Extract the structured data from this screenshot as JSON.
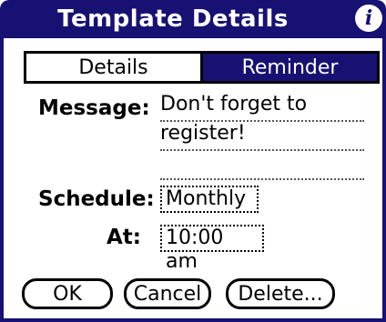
{
  "window": {
    "title": "Template Details",
    "info_icon": "info-icon"
  },
  "tabs": [
    {
      "label": "Details",
      "selected": false
    },
    {
      "label": "Reminder",
      "selected": true
    }
  ],
  "message": {
    "label": "Message:",
    "lines": [
      "Don't forget to",
      "register!",
      ""
    ]
  },
  "schedule": {
    "label": "Schedule:",
    "value": "Monthly"
  },
  "at": {
    "label": "At:",
    "value": "10:00 am"
  },
  "buttons": {
    "ok": "OK",
    "cancel": "Cancel",
    "delete": "Delete..."
  },
  "colors": {
    "accent": "#161172",
    "background": "#ffffff",
    "text": "#000000"
  }
}
